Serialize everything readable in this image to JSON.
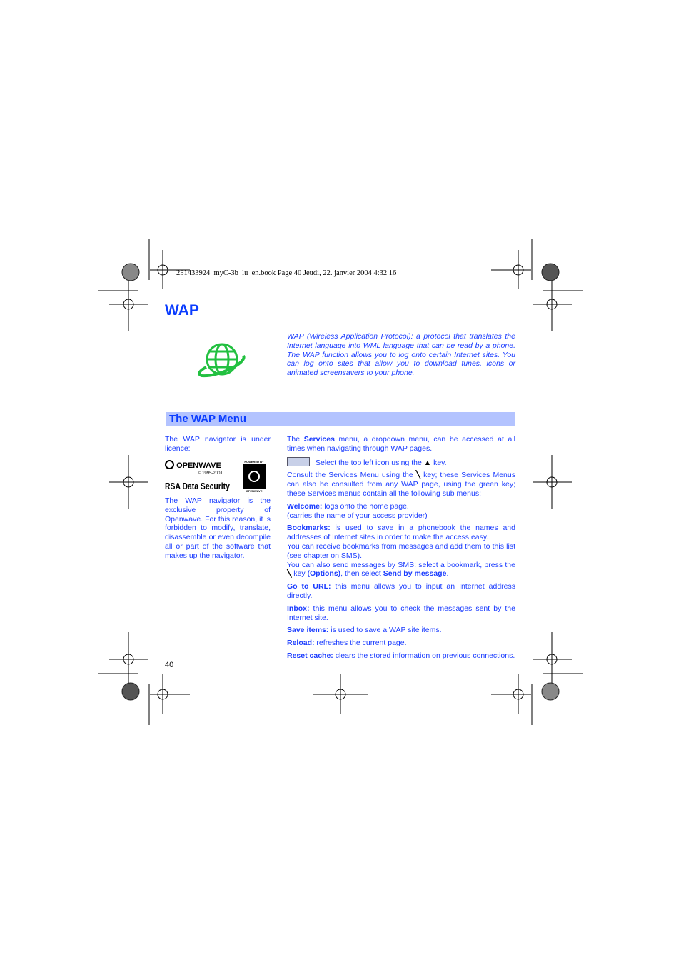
{
  "slug": "251433924_myC-3b_lu_en.book  Page 40  Jeudi, 22. janvier 2004  4:32 16",
  "title": "WAP",
  "intro": "WAP (Wireless Application Protocol): a protocol that translates the Internet language into WML language that can be read by a phone. The WAP function allows you to log onto certain Internet sites. You can log onto sites that allow you to download tunes, icons or animated screensavers to your phone.",
  "section_title": "The WAP Menu",
  "left": {
    "licence": "The WAP navigator is under licence:",
    "logos": {
      "openwave": "OPENWAVE",
      "copyright": "© 1995-2001",
      "rsa": "RSA Data Security",
      "badge_top": "POWERED BY",
      "badge_bottom": "OPENWAVE"
    },
    "property": "The WAP navigator is the exclusive property of Openwave. For this reason, it is forbidden to modify, translate, disassemble or even decompile all or part of the software that makes up the navigator."
  },
  "right": {
    "p1": {
      "a": "The ",
      "b": "Services",
      "c": " menu, a dropdown menu, can be accessed at all times when navigating through WAP pages."
    },
    "p2": {
      "a": "Select the top left icon using the ",
      "b": " key."
    },
    "p3": {
      "a": "Consult the Services Menu using the ",
      "b": " key; these Services Menus can also be consulted from any WAP page, using the green key; these Services menus contain all the following sub menus;"
    },
    "welcome": {
      "label": "Welcome:",
      "text": " logs onto the home page.",
      "note": "(carries the name of your access provider)"
    },
    "bookmarks": {
      "label": "Bookmarks:",
      "text": " is used to save in a phonebook the names and addresses of Internet sites in order to make the access easy.",
      "text2": "You can receive bookmarks from messages and add them to this list (see chapter on SMS).",
      "text3": "You can also send messages by SMS: select a bookmark, press the ",
      "text4": " key ",
      "options": "(Options)",
      "text5": ", then select ",
      "send": "Send by message",
      "text6": "."
    },
    "goto": {
      "label": "Go to URL:",
      "text": " this menu allows you to input an Internet address directly."
    },
    "inbox": {
      "label": "Inbox:",
      "text": " this menu allows you to check the messages sent by the Internet site."
    },
    "save": {
      "label": "Save items:",
      "text": " is used to save a WAP site items."
    },
    "reload": {
      "label": "Reload:",
      "text": " refreshes the current page."
    },
    "reset": {
      "label": "Reset cache:",
      "text": " clears the stored information on previous connections."
    }
  },
  "page_number": "40",
  "colors": {
    "text": "#1a3cff",
    "section_bar": "#b3c3ff",
    "globe": "#22c040"
  },
  "icons": [
    "globe-icon",
    "services-menu-icon",
    "up-arrow-key-icon",
    "left-softkey-icon",
    "registration-mark-icon"
  ]
}
